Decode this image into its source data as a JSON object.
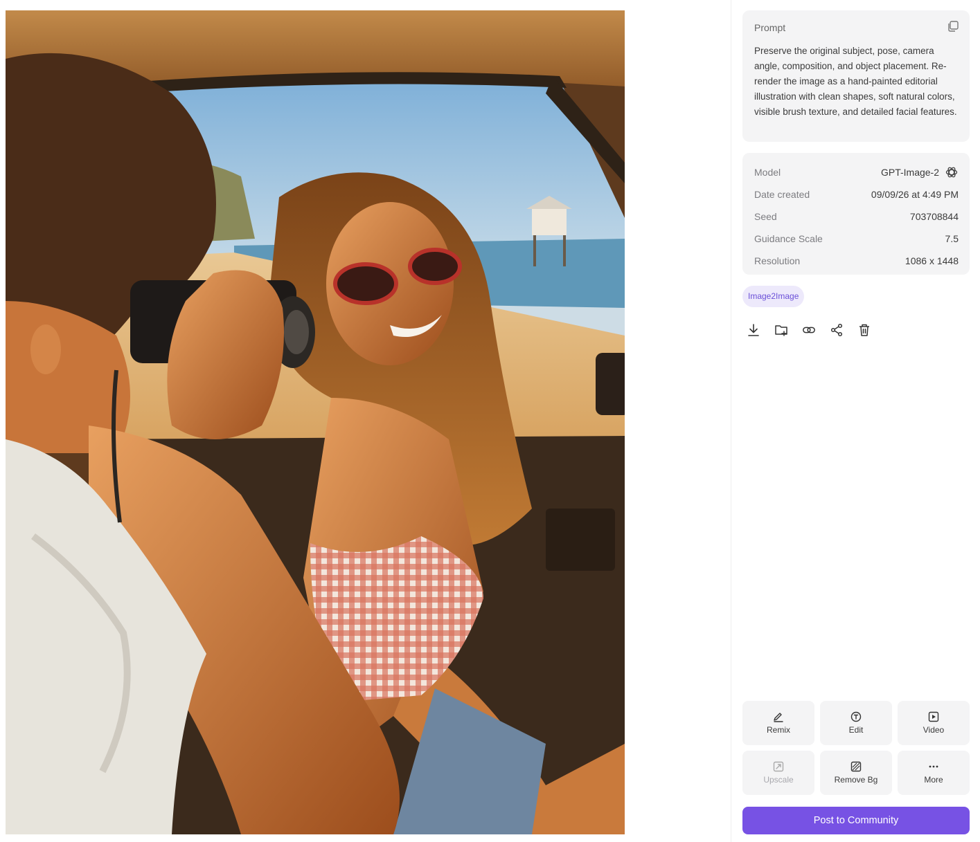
{
  "prompt": {
    "title": "Prompt",
    "text": "Preserve the original subject, pose, camera angle, composition, and object placement. Re-render the image as a hand-painted editorial illustration with clean shapes, soft natural colors, visible brush texture, and detailed facial features.",
    "copy_icon": "copy-icon"
  },
  "meta": {
    "model_label": "Model",
    "model_value": "GPT-Image-2",
    "model_icon": "openai-logo-icon",
    "date_label": "Date created",
    "date_value": "09/09/26 at 4:49 PM",
    "seed_label": "Seed",
    "seed_value": "703708844",
    "guidance_label": "Guidance Scale",
    "guidance_value": "7.5",
    "resolution_label": "Resolution",
    "resolution_value": "1086 x 1448"
  },
  "tag": "Image2Image",
  "actions": [
    "download-icon",
    "add-to-folder-icon",
    "link-icon",
    "share-icon",
    "trash-icon"
  ],
  "tools": {
    "remix": "Remix",
    "edit": "Edit",
    "video": "Video",
    "upscale": "Upscale",
    "remove_bg": "Remove Bg",
    "more": "More"
  },
  "post_button": "Post to Community",
  "colors": {
    "accent": "#7752e4",
    "tag_bg": "#ede9fb",
    "tag_text": "#6a4fd8",
    "card_bg": "#f4f4f5"
  }
}
